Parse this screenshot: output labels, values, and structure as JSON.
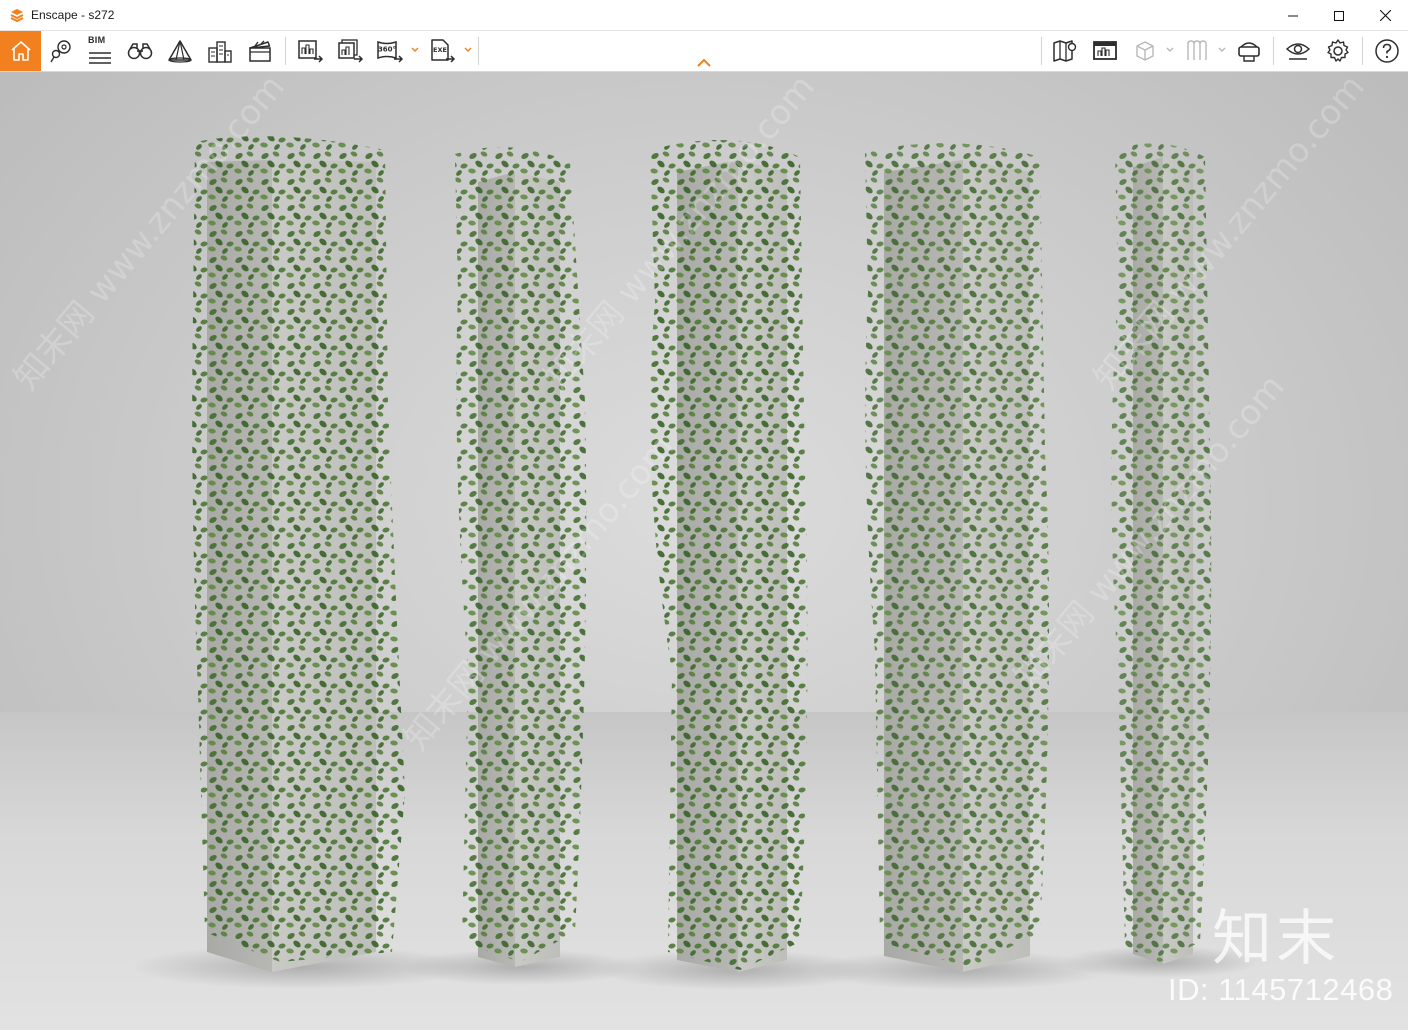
{
  "window": {
    "title": "Enscape - s272"
  },
  "toolbar": {
    "left_items": [
      {
        "name": "home-icon",
        "label": ""
      },
      {
        "name": "views-icon",
        "label": ""
      },
      {
        "name": "bim-icon",
        "label": "BIM"
      },
      {
        "name": "binoculars-icon",
        "label": ""
      },
      {
        "name": "fly-mode-icon",
        "label": ""
      },
      {
        "name": "buildings-icon",
        "label": ""
      },
      {
        "name": "clapperboard-icon",
        "label": ""
      },
      {
        "name": "render-screenshot-icon",
        "label": ""
      },
      {
        "name": "batch-render-icon",
        "label": ""
      },
      {
        "name": "panorama-360-icon",
        "label": "360°"
      },
      {
        "name": "export-exe-icon",
        "label": "EXE"
      }
    ],
    "right_items": [
      {
        "name": "map-icon"
      },
      {
        "name": "view-management-icon"
      },
      {
        "name": "cube-icon"
      },
      {
        "name": "vr-icon"
      },
      {
        "name": "headset-icon"
      },
      {
        "name": "visual-settings-icon"
      },
      {
        "name": "settings-gear-icon"
      },
      {
        "name": "help-icon"
      }
    ],
    "accent_color": "#f2801e"
  },
  "viewport": {
    "watermark_logo": "知末",
    "watermark_id": "ID: 1145712468",
    "watermark_text": "知末网 www.znzmo.com"
  }
}
